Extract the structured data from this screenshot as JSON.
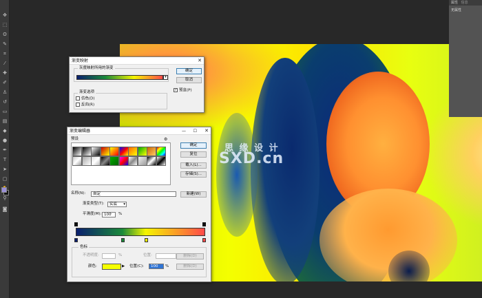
{
  "right_panel": {
    "tab_properties": "属性",
    "tab_info": "信息",
    "no_properties": "无属性"
  },
  "watermark": {
    "cn": "思 缘 设 计",
    "site": "SXD.cn"
  },
  "gradient_map": {
    "title": "渐变映射",
    "group_label": "灰度映射所用的渐变",
    "ok": "确定",
    "cancel": "取消",
    "preview": "预览(P)",
    "options_label": "渐变选项",
    "dither": "仿色(D)",
    "reverse": "反向(R)",
    "gradient_colors": [
      "#0b1f6e",
      "#1a8a3a",
      "#f5f500",
      "#ff4a4a"
    ]
  },
  "gradient_editor": {
    "title": "渐变编辑器",
    "presets_label": "预设",
    "ok": "确定",
    "cancel": "复位",
    "load": "载入(L)...",
    "save": "存储(S)...",
    "name_label": "名称(N):",
    "name_value": "自定",
    "new_button": "新建(W)",
    "type_label": "渐变类型(T):",
    "type_value": "实底",
    "smoothness_label": "平滑度(M):",
    "smoothness_value": "100",
    "smoothness_unit": "%",
    "stops_label": "色标",
    "opacity_label": "不透明度:",
    "opacity_unit": "%",
    "location_label1": "位置:",
    "delete_label1": "删除(D)",
    "color_label": "颜色:",
    "location_label2": "位置(C):",
    "location_value": "100",
    "location_unit": "%",
    "delete_label2": "删除(D)",
    "stop_color": "#f5ff00",
    "gradient_colors": [
      "#0b1f6e",
      "#1a8a3a",
      "#f5f500",
      "#ff4a4a"
    ]
  }
}
